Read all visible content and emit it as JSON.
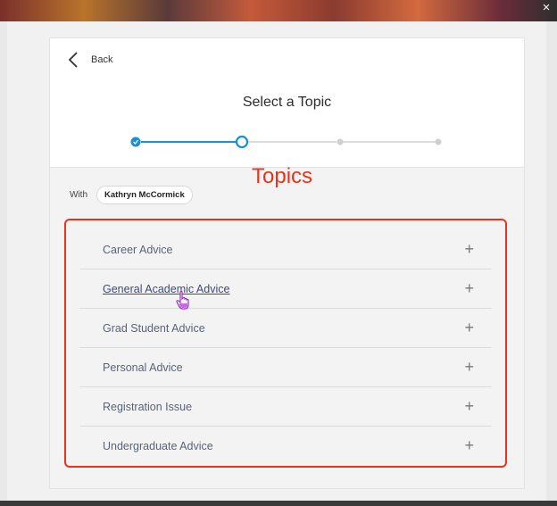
{
  "window": {
    "close_glyph": "×"
  },
  "header": {
    "back_label": "Back",
    "title": "Select a Topic"
  },
  "stepper": {
    "steps": [
      {
        "state": "completed"
      },
      {
        "state": "current"
      },
      {
        "state": "upcoming"
      },
      {
        "state": "upcoming"
      }
    ],
    "colors": {
      "active": "#1a8fd1",
      "inactive": "#d0d0d0"
    }
  },
  "meeting": {
    "with_label": "With",
    "advisor": "Kathryn McCormick"
  },
  "annotation": {
    "text": "Topics",
    "color": "#e8341c"
  },
  "topics": [
    {
      "label": "Career Advice",
      "icon": "plus-icon"
    },
    {
      "label": "General Academic Advice",
      "icon": "plus-icon",
      "hovered": true
    },
    {
      "label": "Grad Student Advice",
      "icon": "plus-icon"
    },
    {
      "label": "Personal Advice",
      "icon": "plus-icon"
    },
    {
      "label": "Registration Issue",
      "icon": "plus-icon"
    },
    {
      "label": "Undergraduate Advice",
      "icon": "plus-icon"
    }
  ]
}
